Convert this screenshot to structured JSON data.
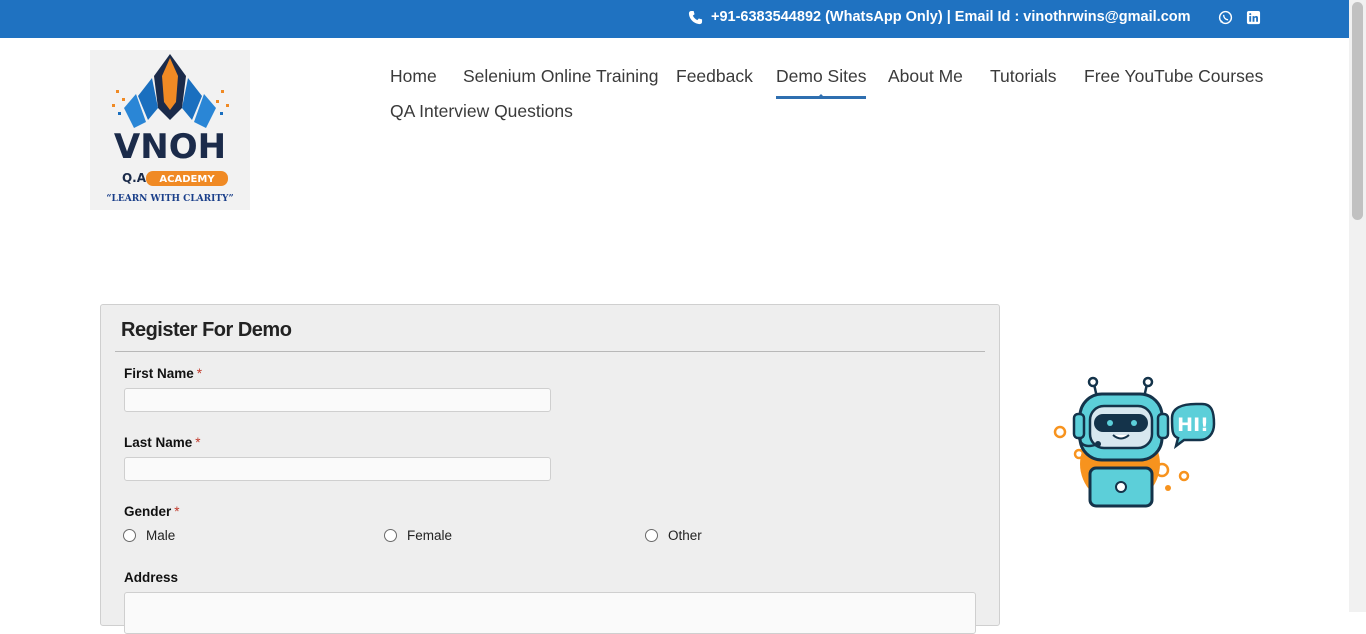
{
  "topbar": {
    "contact": "+91-6383544892 (WhatsApp Only) | Email Id : vinothrwins@gmail.com",
    "icons": [
      "phone-icon",
      "whatsapp-icon",
      "linkedin-icon"
    ]
  },
  "logo": {
    "brand": "VNOH",
    "academy": "ACADEMY",
    "qa": "Q.A",
    "tagline": "“LEARN WITH CLARITY”"
  },
  "nav": {
    "items": [
      {
        "label": "Home"
      },
      {
        "label": "Selenium Online Training"
      },
      {
        "label": "Feedback"
      },
      {
        "label": "Demo Sites",
        "active": true
      },
      {
        "label": "About Me"
      },
      {
        "label": "Tutorials"
      },
      {
        "label": "Free YouTube Courses"
      },
      {
        "label": "QA Interview Questions"
      }
    ]
  },
  "form": {
    "title": "Register For Demo",
    "first_name_label": "First Name",
    "last_name_label": "Last Name",
    "gender_label": "Gender",
    "required_mark": "*",
    "gender_options": [
      "Male",
      "Female",
      "Other"
    ],
    "address_label": "Address",
    "first_name_value": "",
    "last_name_value": "",
    "address_value": ""
  },
  "bot": {
    "bubble_text": "HI!"
  },
  "colors": {
    "topbar": "#1f72c1",
    "nav_active": "#2f6fb0",
    "form_bg": "#eeeeee",
    "required": "#c0392b"
  }
}
